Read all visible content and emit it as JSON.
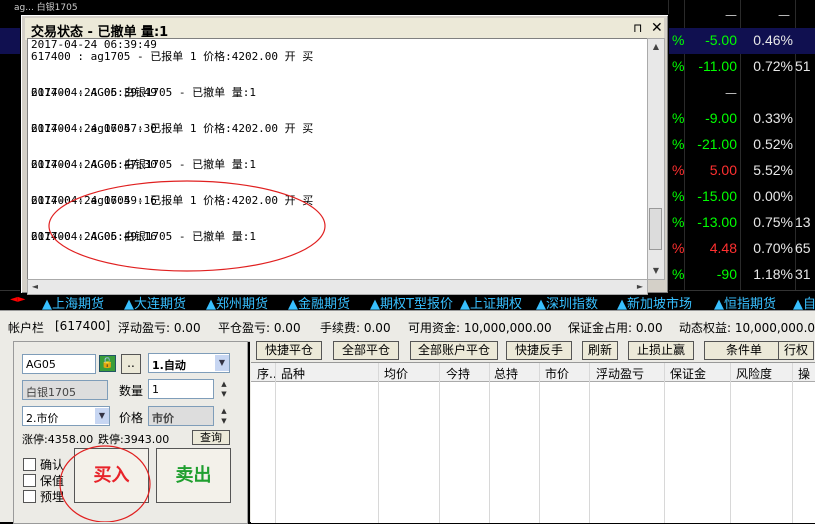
{
  "board": {
    "top_label": "ag... 白银1705",
    "rows": [
      {
        "pct": "%",
        "chg": "-5.00",
        "rate": "0.46%",
        "vol": "",
        "chg_color": "#00ff00"
      },
      {
        "pct": "%",
        "chg": "-11.00",
        "rate": "0.72%",
        "vol": "51",
        "chg_color": "#00ff00"
      },
      {
        "pct": "",
        "chg": "",
        "rate": "",
        "vol": "",
        "chg_color": "#00ff00"
      },
      {
        "pct": "%",
        "chg": "-9.00",
        "rate": "0.33%",
        "vol": "",
        "chg_color": "#00ff00"
      },
      {
        "pct": "%",
        "chg": "-21.00",
        "rate": "0.52%",
        "vol": "",
        "chg_color": "#00ff00"
      },
      {
        "pct": "%",
        "chg": "5.00",
        "rate": "5.52%",
        "vol": "",
        "chg_color": "#ff3030"
      },
      {
        "pct": "%",
        "chg": "-15.00",
        "rate": "0.00%",
        "vol": "",
        "chg_color": "#00ff00"
      },
      {
        "pct": "%",
        "chg": "-13.00",
        "rate": "0.75%",
        "vol": "13",
        "chg_color": "#00ff00"
      },
      {
        "pct": "%",
        "chg": "4.48",
        "rate": "0.70%",
        "vol": "65",
        "chg_color": "#ff3030"
      },
      {
        "pct": "%",
        "chg": "-90",
        "rate": "1.18%",
        "vol": "31",
        "chg_color": "#00ff00"
      }
    ],
    "dashes": [
      "—",
      "—",
      "—"
    ]
  },
  "market_tabs": [
    "▲上海期货",
    "▲大连期货",
    "▲郑州期货",
    "▲金融期货",
    "▲期权T型报价",
    "▲上证期权",
    "▲深圳指数",
    "▲新加坡市场",
    "▲恒指期货",
    "▲自"
  ],
  "dialog": {
    "title": "交易状态 - 已撤单 量:1",
    "pin_icon": "⊓",
    "close_icon": "✕",
    "log": [
      {
        "time": "2017-04-24 06:39:49",
        "msg": "617400 : ag1705 - 已报单 1 价格:4202.00 开 买"
      },
      {
        "time": "2017-04-24 06:39:49",
        "msg": "617400 : AG05 白银1705 - 已撤单 量:1"
      },
      {
        "time": "2017-04-24 06:47:30",
        "msg": "617400 : ag1705 - 已报单 1 价格:4202.00 开 买"
      },
      {
        "time": "2017-04-24 06:47:30",
        "msg": "617400 : AG05 白银1705 - 已撤单 量:1"
      },
      {
        "time": "2017-04-24 06:49:16",
        "msg": "617400 : ag1705 - 已报单 1 价格:4202.00 开 买"
      },
      {
        "time": "2017-04-24 06:49:16",
        "msg": "617400 : AG05 白银1705 - 已撤单 量:1"
      }
    ],
    "first_line": "2017-04-24 06:39:49"
  },
  "account": {
    "label": "帐户栏",
    "account_id": "[617400]",
    "float_pl": "浮动盈亏: 0.00",
    "close_pl": "平仓盈亏: 0.00",
    "fee": "手续费: 0.00",
    "available": "可用资金: 10,000,000.00",
    "margin": "保证金占用: 0.00",
    "equity": "动态权益: 10,000,000.00"
  },
  "order": {
    "code": "AG05",
    "more_btn": "..",
    "mode": "1.自动",
    "name": "白银1705",
    "qty_label": "数量",
    "qty": "1",
    "price_type": "2.市价",
    "price_label": "价格",
    "price_value": "市价",
    "limit_up": "涨停:4358.00",
    "limit_down": "跌停:3943.00",
    "query_btn": "查询",
    "confirm_label": "确认",
    "keep_label": "保值",
    "preset_label": "预埋",
    "buy_btn": "买入",
    "sell_btn": "卖出"
  },
  "toolbar": [
    "快捷平仓",
    "全部平仓",
    "全部账户平仓",
    "快捷反手",
    "刷新",
    "止损止赢",
    "条件单",
    "行权"
  ],
  "grid_headers": [
    "序..",
    "品种",
    "均价",
    "今持",
    "总持",
    "市价",
    "浮动盈亏",
    "保证金",
    "风险度",
    "操"
  ]
}
